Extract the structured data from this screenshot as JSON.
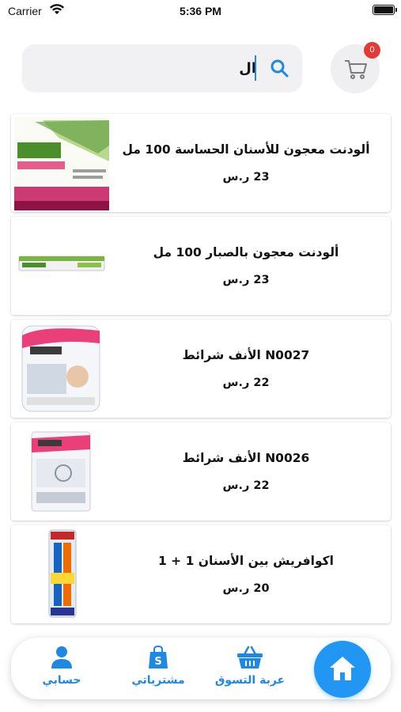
{
  "status_bar": {
    "carrier": "Carrier",
    "time": "5:36 PM"
  },
  "search": {
    "value": "ال",
    "placeholder": ""
  },
  "cart": {
    "badge_count": "0"
  },
  "products": [
    {
      "title": "ألودنت معجون للأسنان الحساسة 100 مل",
      "price": "23 ر.س"
    },
    {
      "title": "ألودنت معجون بالصبار 100 مل",
      "price": "23 ر.س"
    },
    {
      "title": "N0027 الأنف شرائط",
      "price": "22 ر.س"
    },
    {
      "title": "N0026 الأنف شرائط",
      "price": "22 ر.س"
    },
    {
      "title": "اكوافريش  بين الأسنان 1 + 1",
      "price": "20 ر.س"
    }
  ],
  "bottom_nav": {
    "account": "حسابي",
    "purchases": "مشترياتي",
    "shopping_cart": "عربة التسوق"
  },
  "colors": {
    "accent": "#2196f3",
    "badge": "#e53935",
    "label": "#1e88e5"
  }
}
